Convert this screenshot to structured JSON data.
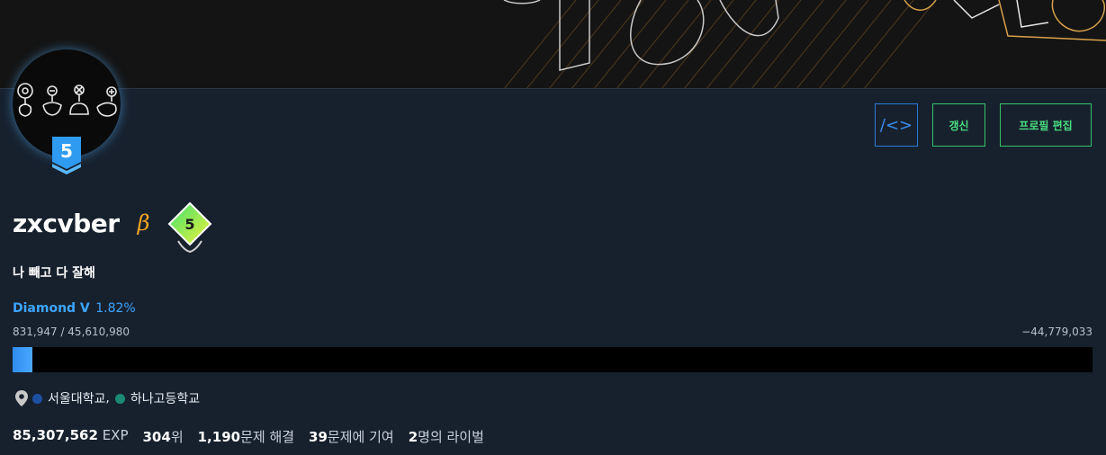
{
  "profile": {
    "username": "zxcvber",
    "beta_mark": "β",
    "bio": "나 빼고 다 잘해",
    "tier_badge_number": "5",
    "level_badge_number": "5"
  },
  "actions": {
    "code_label": "/<>",
    "refresh_label": "갱신",
    "edit_label": "프로필 편집"
  },
  "rating": {
    "tier_name": "Diamond V",
    "tier_percent": "1.82%",
    "current": "831,947 / 45,610,980",
    "remaining": "−44,779,033",
    "progress_fraction": 0.0182
  },
  "organizations": {
    "items": [
      {
        "name": "서울대학교",
        "separator": ",",
        "color": "#1d4fa3"
      },
      {
        "name": "하나고등학교",
        "separator": "",
        "color": "#1a8a74"
      }
    ]
  },
  "stats": {
    "exp_value": "85,307,562",
    "exp_unit": "EXP",
    "rank_value": "304",
    "rank_unit": "위",
    "solved_value": "1,190",
    "solved_unit": "문제 해결",
    "contrib_value": "39",
    "contrib_unit": "문제에 기여",
    "rival_value": "2",
    "rival_unit": "명의 라이벌"
  },
  "colors": {
    "accent_green": "#4ade80",
    "accent_blue": "#3da5ff",
    "beta": "#f5a623"
  }
}
